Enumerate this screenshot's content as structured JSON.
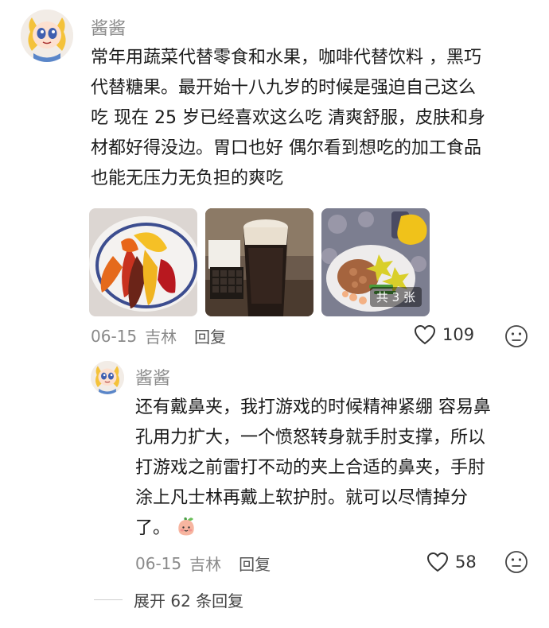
{
  "comments": [
    {
      "username": "酱酱",
      "text_lines": [
        "常年用蔬菜代替零食和水果，咖啡代替饮料 ，黑巧",
        "代替糖果。最开始十八九岁的时候是强迫自己这么",
        "吃 现在 25 岁已经喜欢这么吃 清爽舒服，皮肤和身",
        "材都好得没边。胃口也好 偶尔看到想吃的加工食品",
        "也能无压力无负担的爽吃"
      ],
      "photos": [
        {
          "icon": "peppers-photo"
        },
        {
          "icon": "coffee-chocolate-photo"
        },
        {
          "icon": "meal-plate-photo",
          "count_label": "共 3 张"
        }
      ],
      "date": "06-15",
      "location": "吉林",
      "reply_label": "回复",
      "likes": "109"
    },
    {
      "username": "酱酱",
      "text_lines": [
        "还有戴鼻夹，我打游戏的时候精神紧绷 容易鼻",
        "孔用力扩大，一个愤怒转身就手肘支撑，所以",
        "打游戏之前雷打不动的夹上合适的鼻夹，手肘",
        "涂上凡士林再戴上软护肘。就可以尽情掉分",
        "了。"
      ],
      "emoji": "peach-face-emoji",
      "date": "06-15",
      "location": "吉林",
      "reply_label": "回复",
      "likes": "58"
    }
  ],
  "expand_replies_label": "展开 62 条回复",
  "colors": {
    "meta_gray": "#8a8a8a",
    "text": "#1a1a1a",
    "avatar_bg": "#f1ede9"
  }
}
